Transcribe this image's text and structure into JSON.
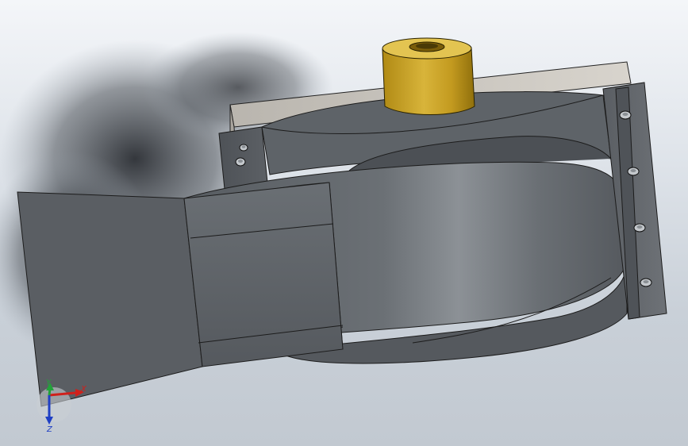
{
  "viewport": {
    "background_top": "#f4f6f9",
    "background_bottom": "#c2c9d1"
  },
  "model": {
    "body_color": "#5c6166",
    "body_highlight": "#8a8f94",
    "boss_color": "#c9a52a",
    "plate_color": "#c9c6c0",
    "bolt_count_left": 2,
    "bolt_count_right": 4
  },
  "triad": {
    "x_label": "X",
    "y_label": "Y",
    "z_label": "Z",
    "x_color": "#d0201b",
    "y_color": "#22a33a",
    "z_color": "#1f3fc4"
  }
}
